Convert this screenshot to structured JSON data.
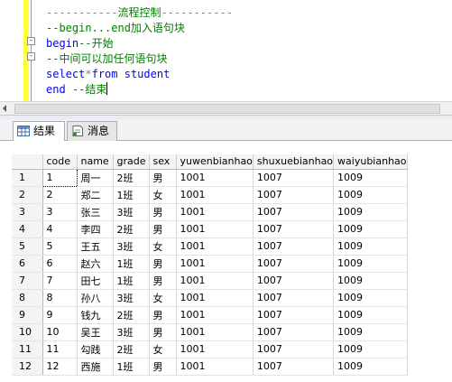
{
  "editor": {
    "lines": [
      {
        "tokens": [
          {
            "t": "-----------",
            "c": "op"
          },
          {
            "t": "流程控制",
            "c": "cm"
          },
          {
            "t": "-----------",
            "c": "op"
          }
        ]
      },
      {
        "tokens": [
          {
            "t": "--begin...end加入语句块",
            "c": "cm"
          }
        ]
      },
      {
        "tokens": [
          {
            "t": "begin",
            "c": "kw"
          },
          {
            "t": "--开始",
            "c": "cm"
          }
        ]
      },
      {
        "tokens": [
          {
            "t": "--中间可以加任何语句块",
            "c": "cm"
          }
        ]
      },
      {
        "tokens": [
          {
            "t": "select",
            "c": "kw"
          },
          {
            "t": "*",
            "c": "op"
          },
          {
            "t": "from",
            "c": "kw"
          },
          {
            "t": " student",
            "c": "kw"
          }
        ]
      },
      {
        "tokens": [
          {
            "t": "end",
            "c": "kw"
          },
          {
            "t": " ",
            "c": "tx"
          },
          {
            "t": "--结束",
            "c": "cm"
          }
        ]
      }
    ],
    "fold_marks": [
      "-",
      "-"
    ]
  },
  "tabs": [
    {
      "label": "结果",
      "icon": "grid-icon",
      "active": true
    },
    {
      "label": "消息",
      "icon": "message-icon",
      "active": false
    }
  ],
  "grid": {
    "columns": [
      "code",
      "name",
      "grade",
      "sex",
      "yuwenbianhao",
      "shuxuebianhao",
      "waiyubianhao"
    ],
    "rows": [
      [
        "1",
        "1",
        "周一",
        "2班",
        "男",
        "1001",
        "1007",
        "1009"
      ],
      [
        "2",
        "2",
        "郑二",
        "1班",
        "女",
        "1001",
        "1007",
        "1009"
      ],
      [
        "3",
        "3",
        "张三",
        "3班",
        "男",
        "1001",
        "1007",
        "1009"
      ],
      [
        "4",
        "4",
        "李四",
        "2班",
        "男",
        "1001",
        "1007",
        "1009"
      ],
      [
        "5",
        "5",
        "王五",
        "3班",
        "女",
        "1001",
        "1007",
        "1009"
      ],
      [
        "6",
        "6",
        "赵六",
        "1班",
        "男",
        "1001",
        "1007",
        "1009"
      ],
      [
        "7",
        "7",
        "田七",
        "1班",
        "男",
        "1001",
        "1007",
        "1009"
      ],
      [
        "8",
        "8",
        "孙八",
        "3班",
        "女",
        "1001",
        "1007",
        "1009"
      ],
      [
        "9",
        "9",
        "钱九",
        "2班",
        "男",
        "1001",
        "1007",
        "1009"
      ],
      [
        "10",
        "10",
        "吴王",
        "3班",
        "男",
        "1001",
        "1007",
        "1009"
      ],
      [
        "11",
        "11",
        "勾践",
        "2班",
        "女",
        "1001",
        "1007",
        "1009"
      ],
      [
        "12",
        "12",
        "西施",
        "1班",
        "男",
        "1001",
        "1007",
        "1009"
      ]
    ]
  }
}
